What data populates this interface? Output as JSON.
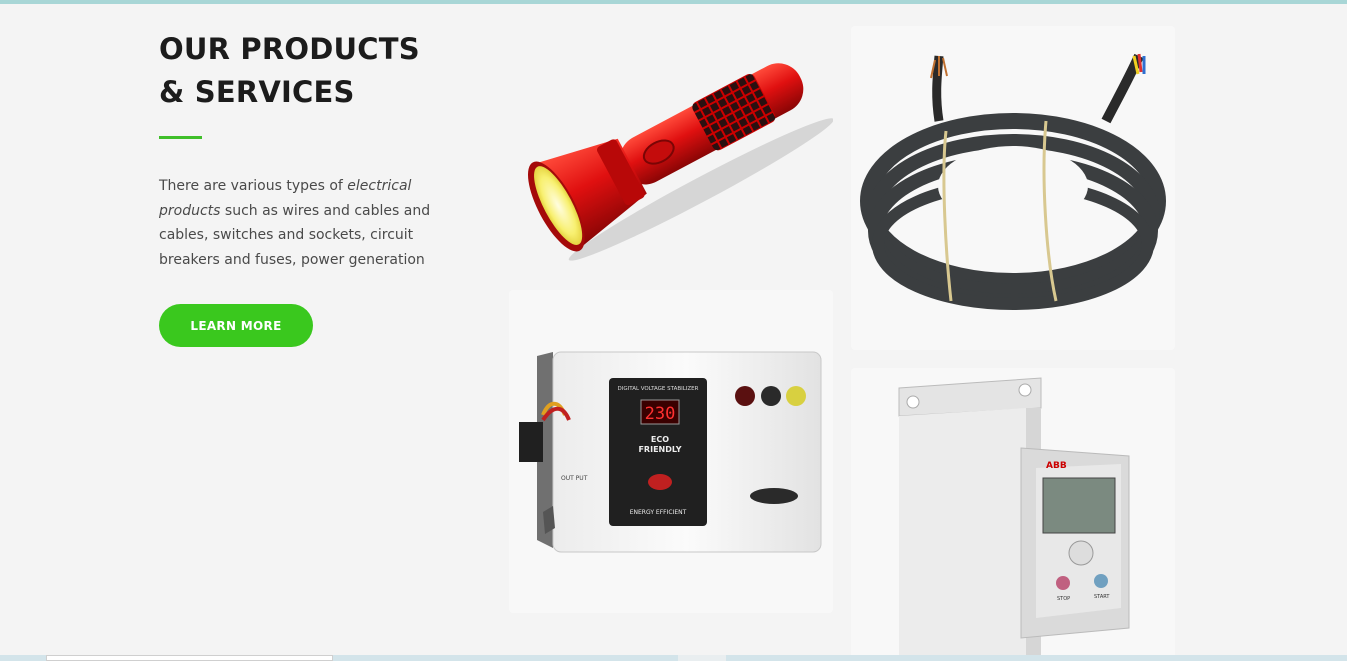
{
  "section": {
    "title_line1": "OUR PRODUCTS",
    "title_line2": "& SERVICES",
    "desc_part1": "There are various types of ",
    "desc_em": "electrical products",
    "desc_part2": " such as wires and cables and cables, switches and sockets, circuit breakers and fuses, power generation",
    "button_label": "LEARN MORE"
  },
  "products": {
    "stabilizer": {
      "display_value": "230",
      "panel_title": "DIGITAL VOLTAGE STABILIZER",
      "eco_line1": "ECO",
      "eco_line2": "FRIENDLY",
      "energy_label": "ENERGY EFFICIENT",
      "output_label": "OUT PUT"
    },
    "drive": {
      "brand": "ABB",
      "stop_label": "STOP",
      "start_label": "START"
    }
  },
  "colors": {
    "accent_green": "#3ac81e",
    "rule_green": "#3fbf2a",
    "top_bar": "#a8d6d6"
  }
}
